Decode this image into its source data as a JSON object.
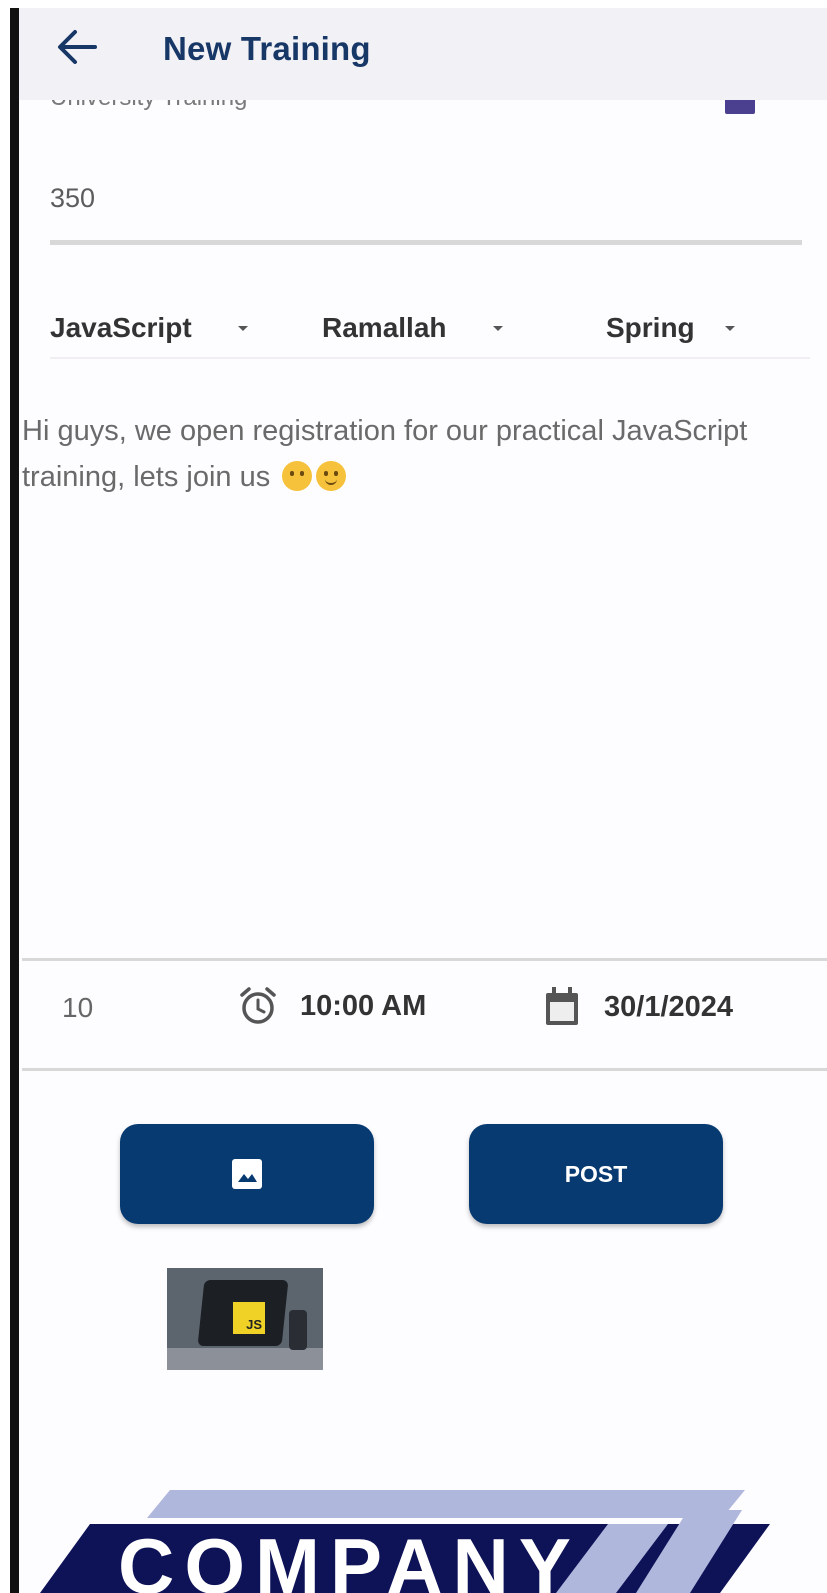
{
  "app_bar": {
    "title": "New Training",
    "back_icon": "arrow-left-icon"
  },
  "form": {
    "previous_field_text": "University Training",
    "price_value": "350",
    "dropdowns": {
      "language": "JavaScript",
      "city": "Ramallah",
      "framework": "Spring"
    },
    "description": "Hi guys, we open registration for our practical JavaScript training, lets join us",
    "seats_value": "10",
    "time_value": "10:00 AM",
    "date_value": "30/1/2024"
  },
  "actions": {
    "image_button_icon": "image-icon",
    "post_label": "POST"
  },
  "attachment": {
    "thumbnail_label": "JS"
  },
  "watermark": {
    "text": "COMPANY"
  },
  "colors": {
    "primary": "#063a71",
    "title": "#173766",
    "app_bar_bg": "#f2f1f6",
    "watermark_dark": "#0e1257",
    "watermark_light": "#b0b7dd"
  }
}
